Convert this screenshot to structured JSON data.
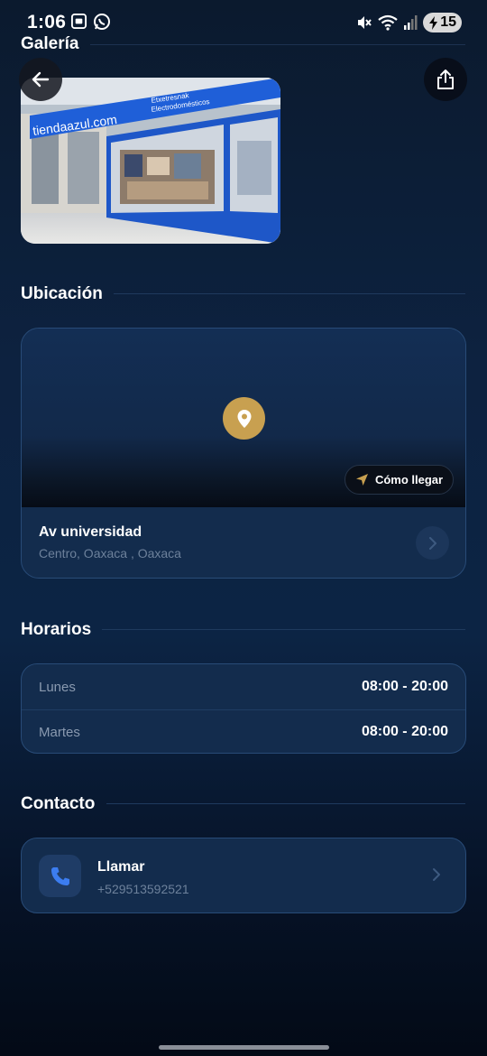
{
  "status_bar": {
    "time": "1:06",
    "battery": "15",
    "left_icons": [
      "screenshot-icon",
      "whatsapp-icon"
    ],
    "right_icons": [
      "mute-icon",
      "wifi-icon",
      "signal-icon",
      "battery-icon"
    ]
  },
  "gallery": {
    "title": "Galería",
    "image_alt_icon": "store-photo",
    "store_sign_text": "tiendaazul.com",
    "store_sign_sub_1": "Etxetresnak",
    "store_sign_sub_2": "Electrodomésticos"
  },
  "location": {
    "title": "Ubicación",
    "directions_label": "Cómo llegar",
    "address_line": "Av universidad",
    "address_detail": "Centro, Oaxaca , Oaxaca"
  },
  "hours": {
    "title": "Horarios",
    "rows": [
      {
        "day": "Lunes",
        "time": "08:00 - 20:00"
      },
      {
        "day": "Martes",
        "time": "08:00 - 20:00"
      }
    ]
  },
  "contact": {
    "title": "Contacto",
    "call_label": "Llamar",
    "phone": "+529513592521"
  },
  "colors": {
    "accent_gold": "#c8a050",
    "card_bg": "#132c4d",
    "card_border": "#284b77",
    "muted_text": "#6d819b"
  }
}
